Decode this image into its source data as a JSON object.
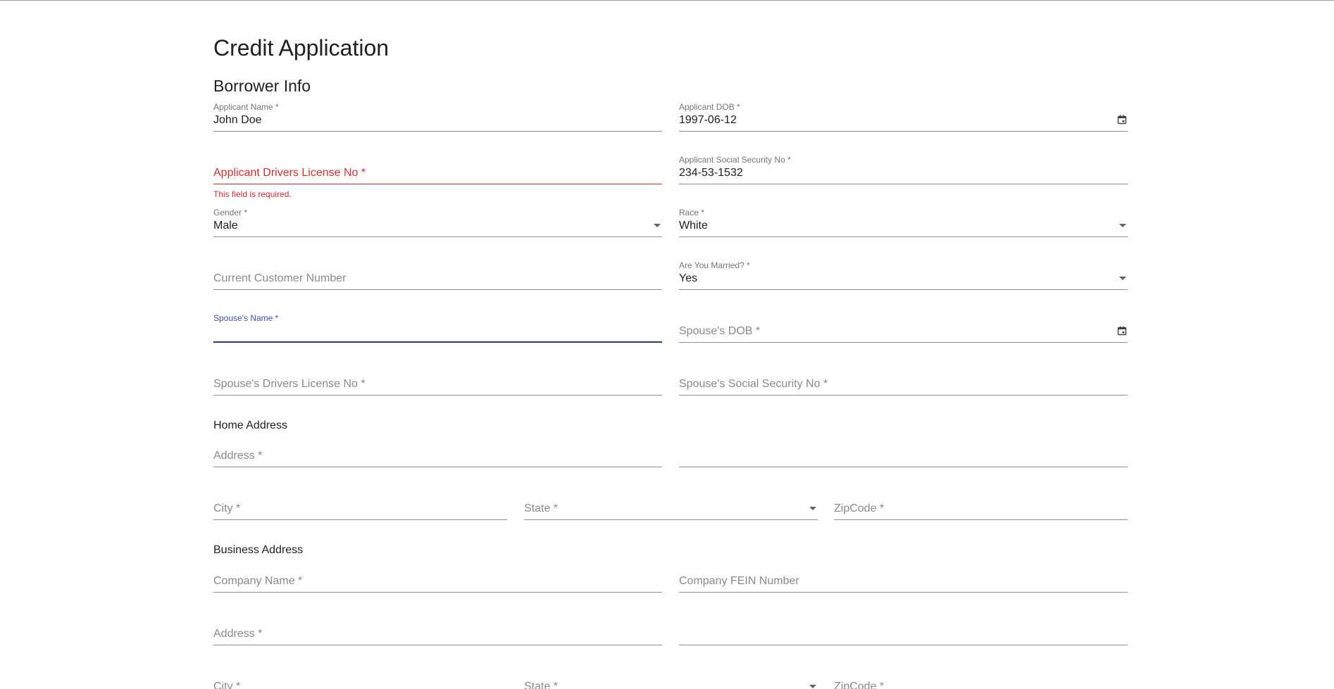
{
  "page": {
    "title": "Credit Application",
    "section": "Borrower Info"
  },
  "borrower": {
    "applicant_name": {
      "label": "Applicant Name *",
      "value": "John Doe"
    },
    "applicant_dob": {
      "label": "Applicant DOB *",
      "value": "1997-06-12",
      "icon": "calendar-icon"
    },
    "drivers_license": {
      "placeholder": "Applicant Drivers License No *",
      "error": "This field is required."
    },
    "ssn": {
      "label": "Applicant Social Security No *",
      "value": "234-53-1532"
    },
    "gender": {
      "label": "Gender *",
      "value": "Male"
    },
    "race": {
      "label": "Race *",
      "value": "White"
    },
    "customer_number": {
      "placeholder": "Current Customer Number"
    },
    "married": {
      "label": "Are You Married? *",
      "value": "Yes"
    },
    "spouse_name": {
      "label": "Spouse's Name *",
      "value": ""
    },
    "spouse_dob": {
      "placeholder": "Spouse's DOB *",
      "icon": "calendar-icon"
    },
    "spouse_license": {
      "placeholder": "Spouse's Drivers License No *"
    },
    "spouse_ssn": {
      "placeholder": "Spouse's Social Security No *"
    }
  },
  "home_address": {
    "heading": "Home Address",
    "address": {
      "placeholder": "Address *"
    },
    "address2": {
      "placeholder": ""
    },
    "city": {
      "placeholder": "City *"
    },
    "state": {
      "placeholder": "State *"
    },
    "zip": {
      "placeholder": "ZipCode *"
    }
  },
  "business_address": {
    "heading": "Business Address",
    "company_name": {
      "placeholder": "Company Name *"
    },
    "fein": {
      "placeholder": "Company FEIN Number"
    },
    "address": {
      "placeholder": "Address *"
    },
    "address2": {
      "placeholder": ""
    },
    "city": {
      "placeholder": "City *"
    },
    "state": {
      "placeholder": "State *"
    },
    "zip": {
      "placeholder": "ZipCode *"
    }
  },
  "colors": {
    "error": "#d32f2f",
    "focus": "#3f51b5",
    "text": "#212121",
    "muted": "#757575"
  }
}
